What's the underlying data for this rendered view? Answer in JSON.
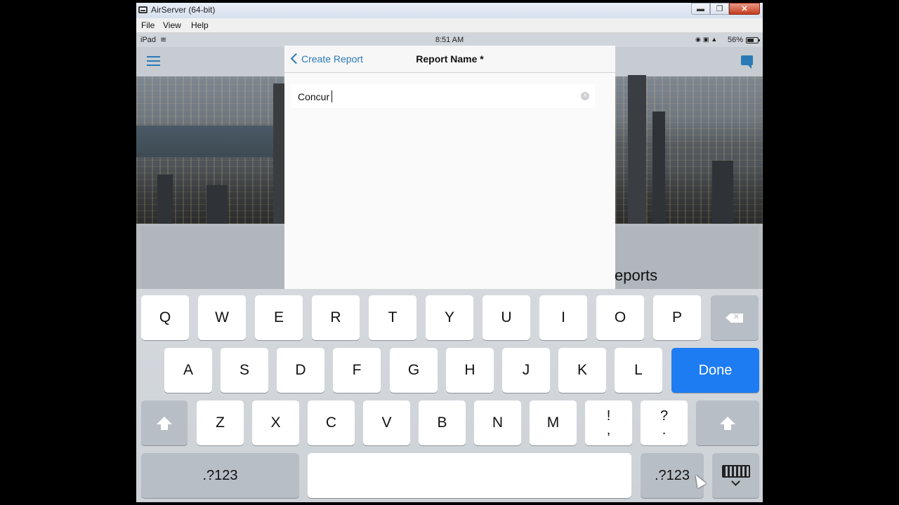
{
  "window": {
    "title": "AirServer (64-bit)",
    "buttons": {
      "minimize": "▬",
      "maximize": "❐",
      "close": "✕"
    }
  },
  "menubar": {
    "items": [
      "File",
      "View",
      "Help"
    ]
  },
  "status_bar": {
    "device": "iPad",
    "time": "8:51 AM",
    "battery": "56%"
  },
  "background": {
    "partial_title": "eports"
  },
  "modal": {
    "back_label": "Create Report",
    "title": "Report Name *",
    "field_value": "Concur"
  },
  "keyboard": {
    "row1": [
      "Q",
      "W",
      "E",
      "R",
      "T",
      "Y",
      "U",
      "I",
      "O",
      "P"
    ],
    "row2": [
      "A",
      "S",
      "D",
      "F",
      "G",
      "H",
      "J",
      "K",
      "L"
    ],
    "row3": [
      "Z",
      "X",
      "C",
      "V",
      "B",
      "N",
      "M"
    ],
    "punct1": {
      "top": "!",
      "bottom": ","
    },
    "punct2": {
      "top": "?",
      "bottom": "."
    },
    "done_label": "Done",
    "numbers_label": ".?123"
  },
  "colors": {
    "accent": "#2a7ab8",
    "done_key": "#1e7cf2"
  }
}
